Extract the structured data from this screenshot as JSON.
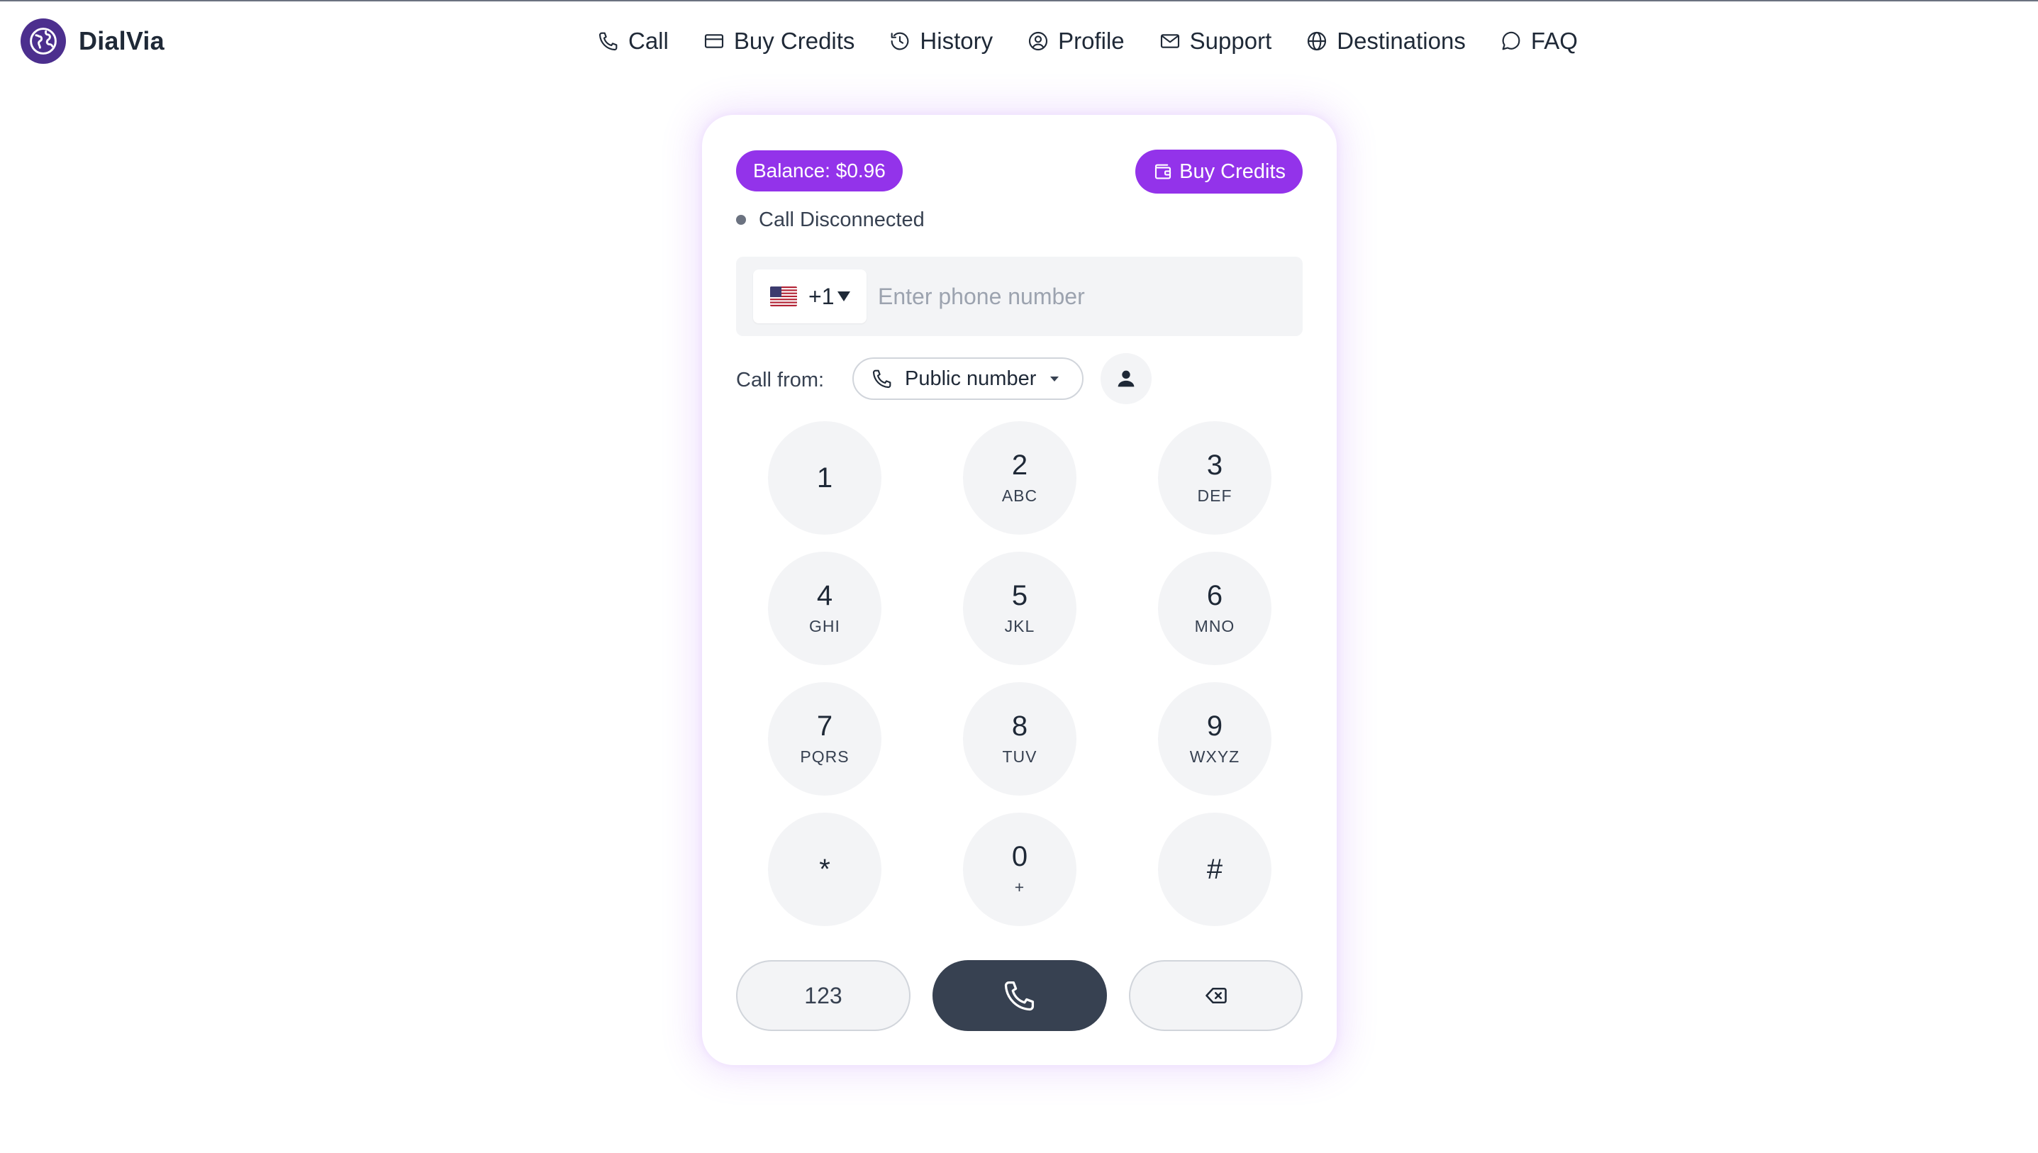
{
  "brand": {
    "name": "DialVia"
  },
  "nav": [
    {
      "label": "Call",
      "icon": "phone-icon"
    },
    {
      "label": "Buy Credits",
      "icon": "credit-card-icon"
    },
    {
      "label": "History",
      "icon": "history-icon"
    },
    {
      "label": "Profile",
      "icon": "user-circle-icon"
    },
    {
      "label": "Support",
      "icon": "mail-icon"
    },
    {
      "label": "Destinations",
      "icon": "globe-icon"
    },
    {
      "label": "FAQ",
      "icon": "chat-bubble-icon"
    }
  ],
  "dialer": {
    "balance": "Balance: $0.96",
    "buy_credits_label": "Buy Credits",
    "status": "Call Disconnected",
    "country_code": "+1",
    "phone_placeholder": "Enter phone number",
    "phone_value": "",
    "call_from_label": "Call from:",
    "call_from_value": "Public number",
    "keys": [
      {
        "digit": "1",
        "letters": ""
      },
      {
        "digit": "2",
        "letters": "ABC"
      },
      {
        "digit": "3",
        "letters": "DEF"
      },
      {
        "digit": "4",
        "letters": "GHI"
      },
      {
        "digit": "5",
        "letters": "JKL"
      },
      {
        "digit": "6",
        "letters": "MNO"
      },
      {
        "digit": "7",
        "letters": "PQRS"
      },
      {
        "digit": "8",
        "letters": "TUV"
      },
      {
        "digit": "9",
        "letters": "WXYZ"
      },
      {
        "digit": "*",
        "letters": ""
      },
      {
        "digit": "0",
        "letters": "+"
      },
      {
        "digit": "#",
        "letters": ""
      }
    ],
    "mode_button_label": "123"
  },
  "colors": {
    "accent": "#9333ea",
    "brand_logo": "#4c2f8e",
    "call_button": "#374151",
    "key_background": "#f3f4f6",
    "status_dot": "#6b7280"
  }
}
